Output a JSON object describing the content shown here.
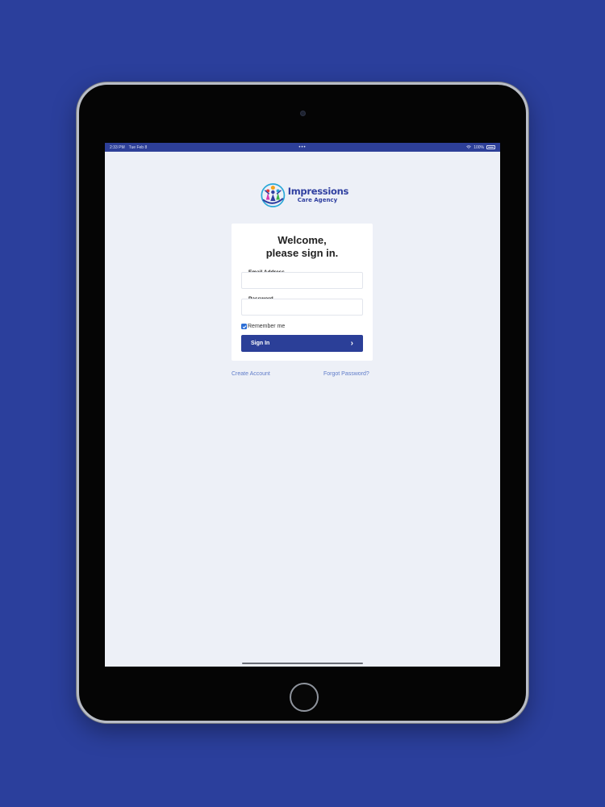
{
  "status_bar": {
    "time": "2:33 PM",
    "date": "Tue Feb 8",
    "dots": "•••",
    "battery": "100%"
  },
  "logo": {
    "line1": "Impressions",
    "line2": "Care Agency"
  },
  "signin": {
    "title_line1": "Welcome,",
    "title_line2": "please sign in.",
    "email_label": "Email Address",
    "email_value": "",
    "password_label": "Password",
    "password_value": "",
    "remember_label": "Remember me",
    "remember_checked": true,
    "button_label": "Sign In",
    "button_chevron": "›"
  },
  "links": {
    "create_account": "Create Account",
    "forgot_password": "Forgot Password?"
  },
  "colors": {
    "page_background": "#2b3f9c",
    "screen_background": "#edf0f7",
    "primary": "#2b3f98",
    "link": "#5f7cc9",
    "checkbox": "#2d6fd6"
  }
}
